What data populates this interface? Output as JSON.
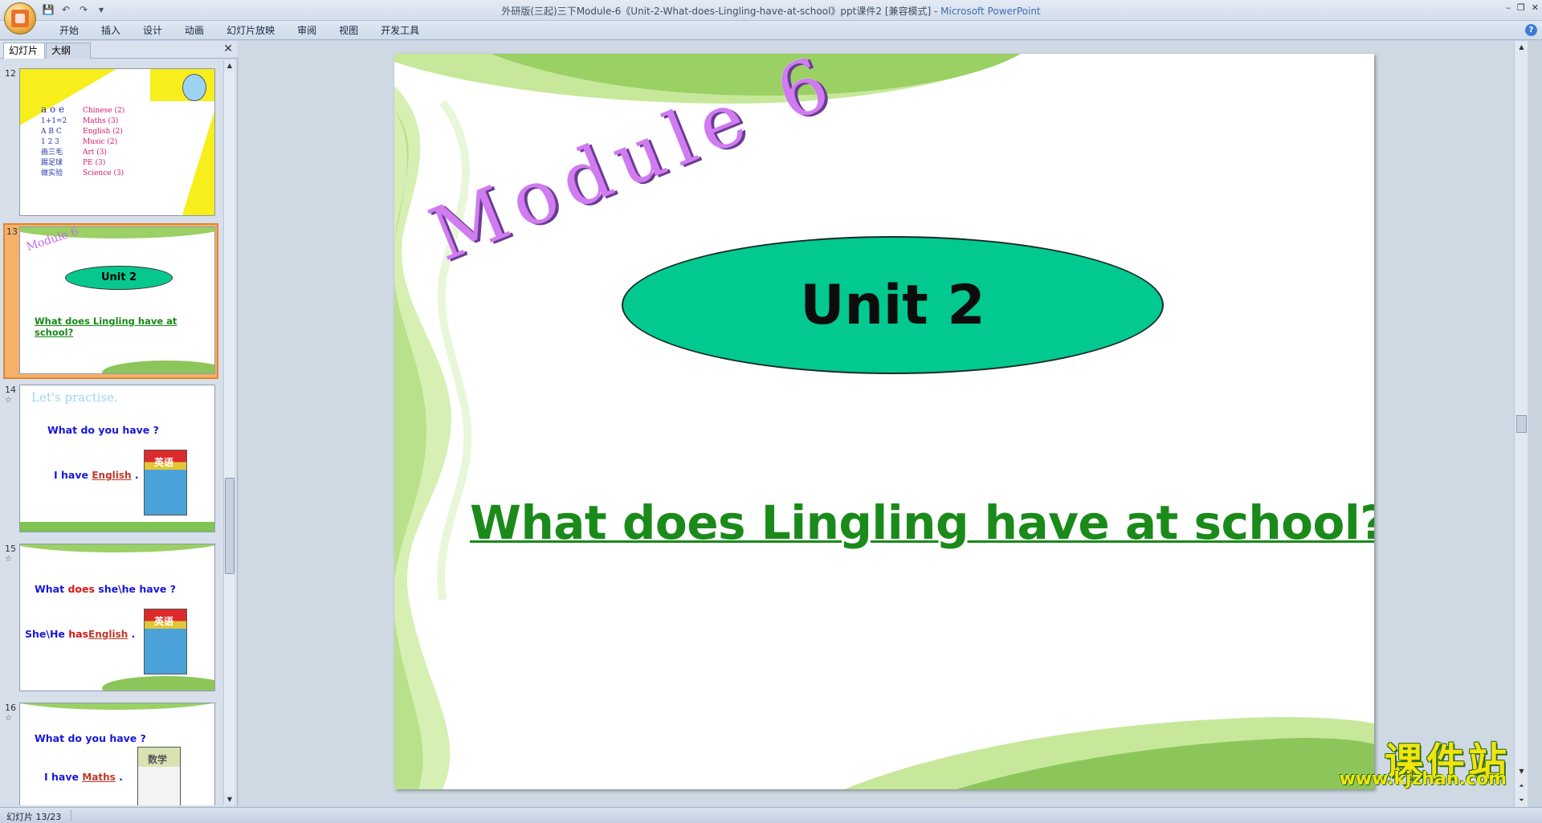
{
  "window": {
    "title": "外研版(三起)三下Module-6《Unit-2-What-does-Lingling-have-at-school》ppt课件2 [兼容模式] - ",
    "app_name": "Microsoft PowerPoint"
  },
  "quick_access": {
    "save": "💾",
    "undo": "↶",
    "redo": "↷",
    "more": "▾"
  },
  "window_controls": {
    "minimize": "–",
    "restore": "❐",
    "close": "✕"
  },
  "ribbon_tabs": [
    "开始",
    "插入",
    "设计",
    "动画",
    "幻灯片放映",
    "审阅",
    "视图",
    "开发工具"
  ],
  "help": "?",
  "panel": {
    "tab_slides": "幻灯片",
    "tab_outline": "大纲",
    "close": "✕"
  },
  "thumbnails": {
    "t12": {
      "num": "12",
      "rows": [
        [
          "a o e",
          "Chinese (2)"
        ],
        [
          "1+1=2",
          "Maths (3)"
        ],
        [
          "A B C",
          "English (2)"
        ],
        [
          "1 2 3",
          "Music (2)"
        ],
        [
          "画三毛",
          "Art (3)"
        ],
        [
          "踢足球",
          "PE (3)"
        ],
        [
          "做实验",
          "Science (3)"
        ]
      ]
    },
    "t13": {
      "num": "13",
      "module": "Module 6",
      "unit": "Unit 2",
      "question": "What does Lingling have at school?"
    },
    "t14": {
      "num": "14",
      "star": "☆",
      "heading": "Let's practise.",
      "q": "What do you have ?",
      "a_prefix": "I have ",
      "a_blank": "English",
      "a_suffix": " .",
      "book": "英语"
    },
    "t15": {
      "num": "15",
      "star": "☆",
      "q_a": "What ",
      "q_b": "does",
      "q_c": " she\\he have ?",
      "a_prefix": "She\\He ",
      "a_has": "has",
      "a_blank": "English",
      "a_suffix": " .",
      "book": "英语"
    },
    "t16": {
      "num": "16",
      "star": "☆",
      "q": "What do you have ?",
      "a_prefix": "I have ",
      "a_blank": "Maths",
      "a_suffix": " .",
      "book": "数学"
    }
  },
  "slide": {
    "module_title": "Module 6",
    "unit_label": "Unit 2",
    "question": "What does Lingling have at school?",
    "colors": {
      "oval": "#02c990",
      "question": "#1a8a1a",
      "module": "#d07cf0",
      "green_light": "#c7e89a",
      "green_dark": "#8cc65a"
    }
  },
  "watermark": {
    "cn": "课件站",
    "url": "www.kjzhan.com"
  },
  "status": {
    "slide_indicator": "幻灯片 13/23"
  }
}
